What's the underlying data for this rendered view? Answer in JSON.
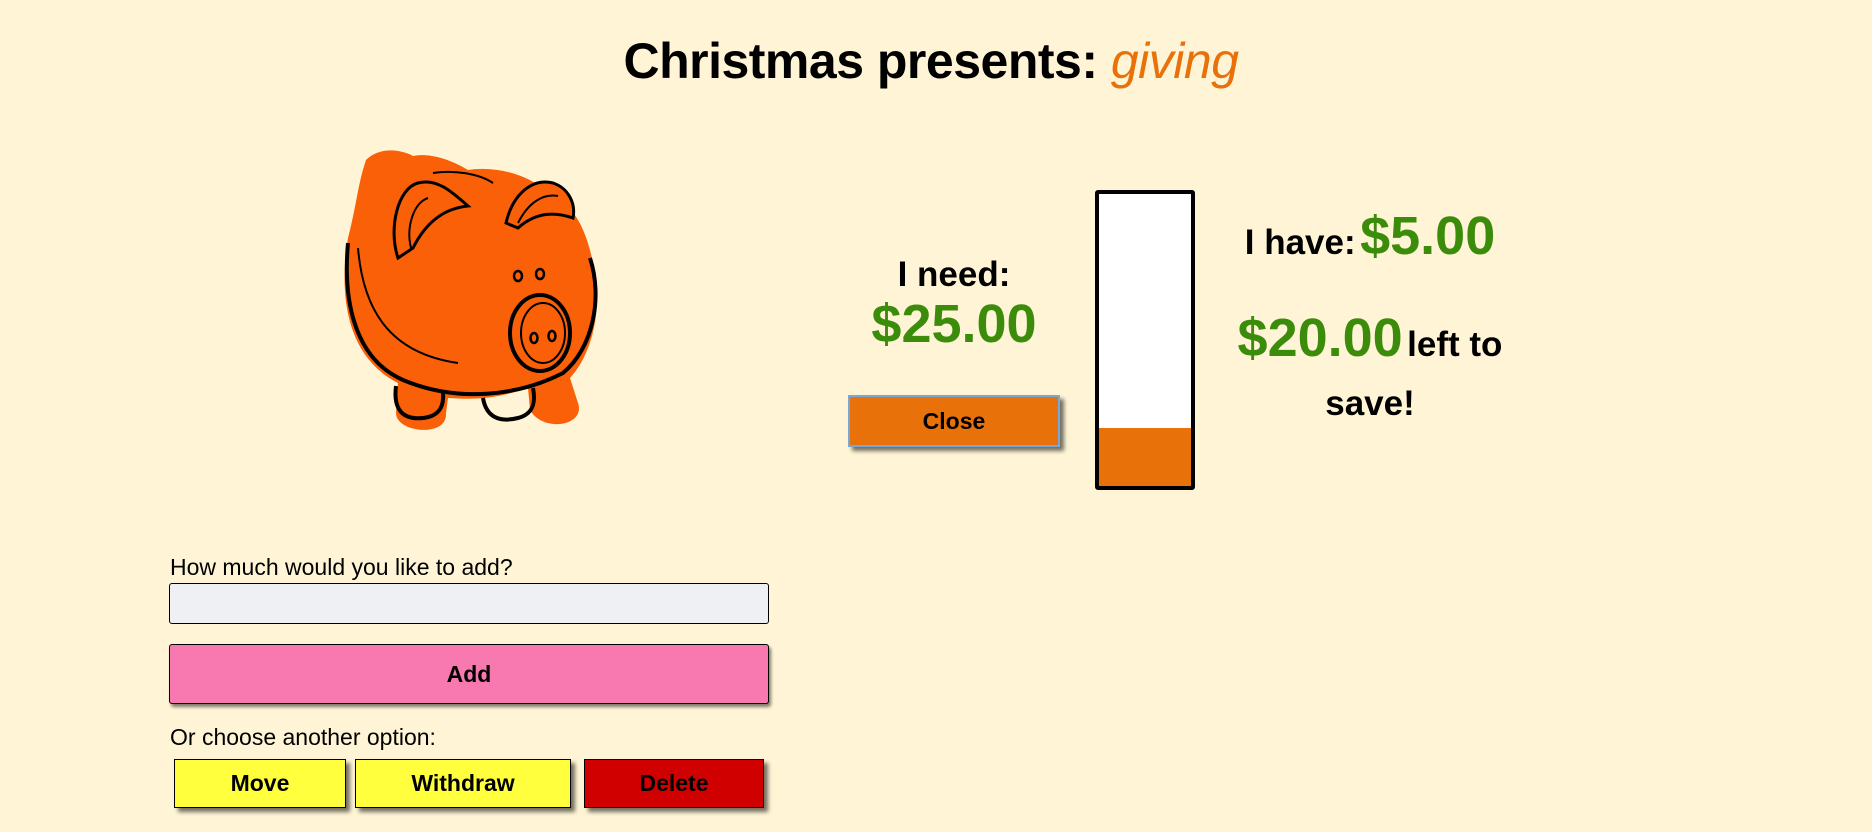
{
  "header": {
    "title_prefix": "Christmas presents:",
    "goal_name": "giving"
  },
  "icons": {
    "piggy_bank": "piggy-bank-icon"
  },
  "need": {
    "label": "I need:",
    "amount": "$25.00"
  },
  "close_button": "Close",
  "jar": {
    "saved": 5,
    "goal": 25,
    "fill_fraction": 0.2
  },
  "have": {
    "label": "I have:",
    "amount": "$5.00"
  },
  "remaining": {
    "amount": "$20.00",
    "text": "left to save!"
  },
  "add_form": {
    "prompt": "How much would you like to add?",
    "input_value": "",
    "input_placeholder": "",
    "add_button": "Add"
  },
  "options": {
    "label": "Or choose another option:",
    "move_button": "Move",
    "withdraw_button": "Withdraw",
    "delete_button": "Delete"
  },
  "colors": {
    "background": "#fff5d6",
    "accent_orange": "#e8710a",
    "money_green": "#3c8c0c",
    "add_pink": "#f878b0",
    "option_yellow": "#ffff3d",
    "delete_red": "#d10000"
  }
}
